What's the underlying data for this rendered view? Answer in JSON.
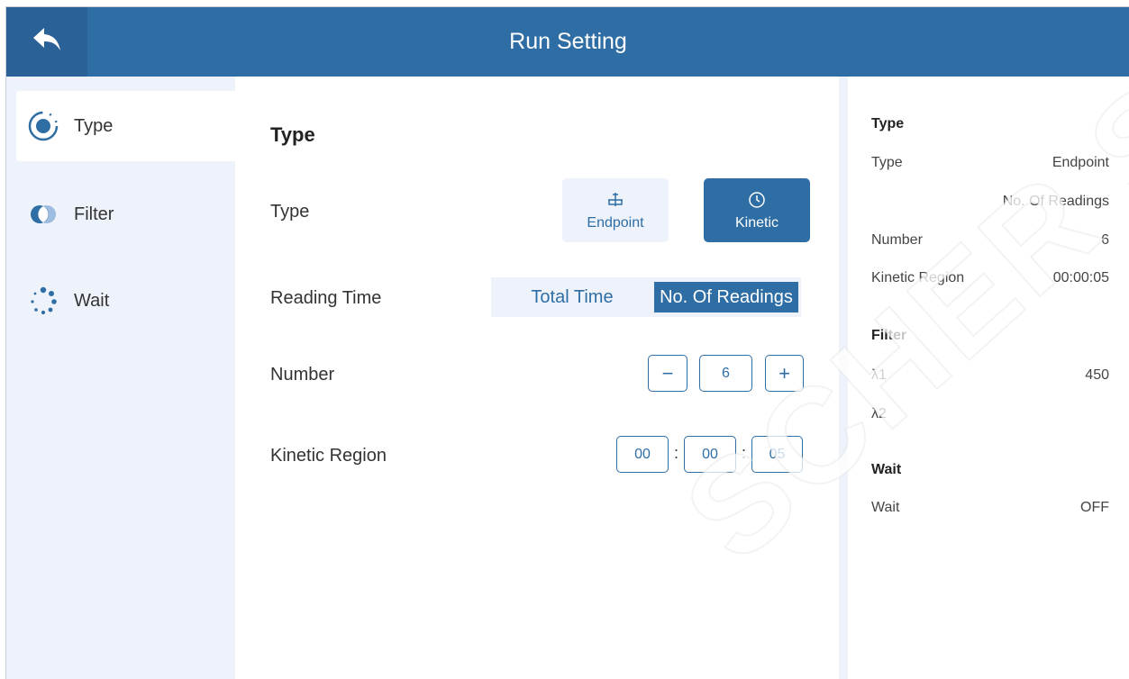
{
  "header": {
    "title": "Run Setting"
  },
  "sidebar": {
    "items": [
      {
        "label": "Type",
        "icon": "radio-target-icon",
        "active": true
      },
      {
        "label": "Filter",
        "icon": "filter-circles-icon",
        "active": false
      },
      {
        "label": "Wait",
        "icon": "loading-dots-icon",
        "active": false
      }
    ]
  },
  "main": {
    "section_title": "Type",
    "rows": {
      "type_label": "Type",
      "reading_time_label": "Reading Time",
      "number_label": "Number",
      "kinetic_region_label": "Kinetic Region"
    },
    "type_options": [
      {
        "label": "Endpoint",
        "icon": "endpoint-icon",
        "selected": false
      },
      {
        "label": "Kinetic",
        "icon": "clock-icon",
        "selected": true
      }
    ],
    "reading_time_options": [
      {
        "label": "Total Time",
        "selected": false
      },
      {
        "label": "No. Of Readings",
        "selected": true
      }
    ],
    "number": {
      "minus": "−",
      "value": "6",
      "plus": "+"
    },
    "kinetic_region": {
      "hh": "00",
      "mm": "00",
      "ss": "05",
      "separator": ":"
    }
  },
  "summary": {
    "type_title": "Type",
    "type_label": "Type",
    "type_value": "Endpoint",
    "readings_mode": "No. Of Readings",
    "number_label": "Number",
    "number_value": "6",
    "kinetic_label": "Kinetic Region",
    "kinetic_value": "00:00:05",
    "filter_title": "Filter",
    "l1_label": "λ1",
    "l1_value": "450",
    "l2_label": "λ2",
    "wait_title": "Wait",
    "wait_label": "Wait",
    "wait_value": "OFF"
  },
  "watermark": "SCHER SAS",
  "colors": {
    "accent": "#2f6ea5",
    "accent_dark": "#2a6297",
    "panel_bg": "#eef2fb"
  }
}
